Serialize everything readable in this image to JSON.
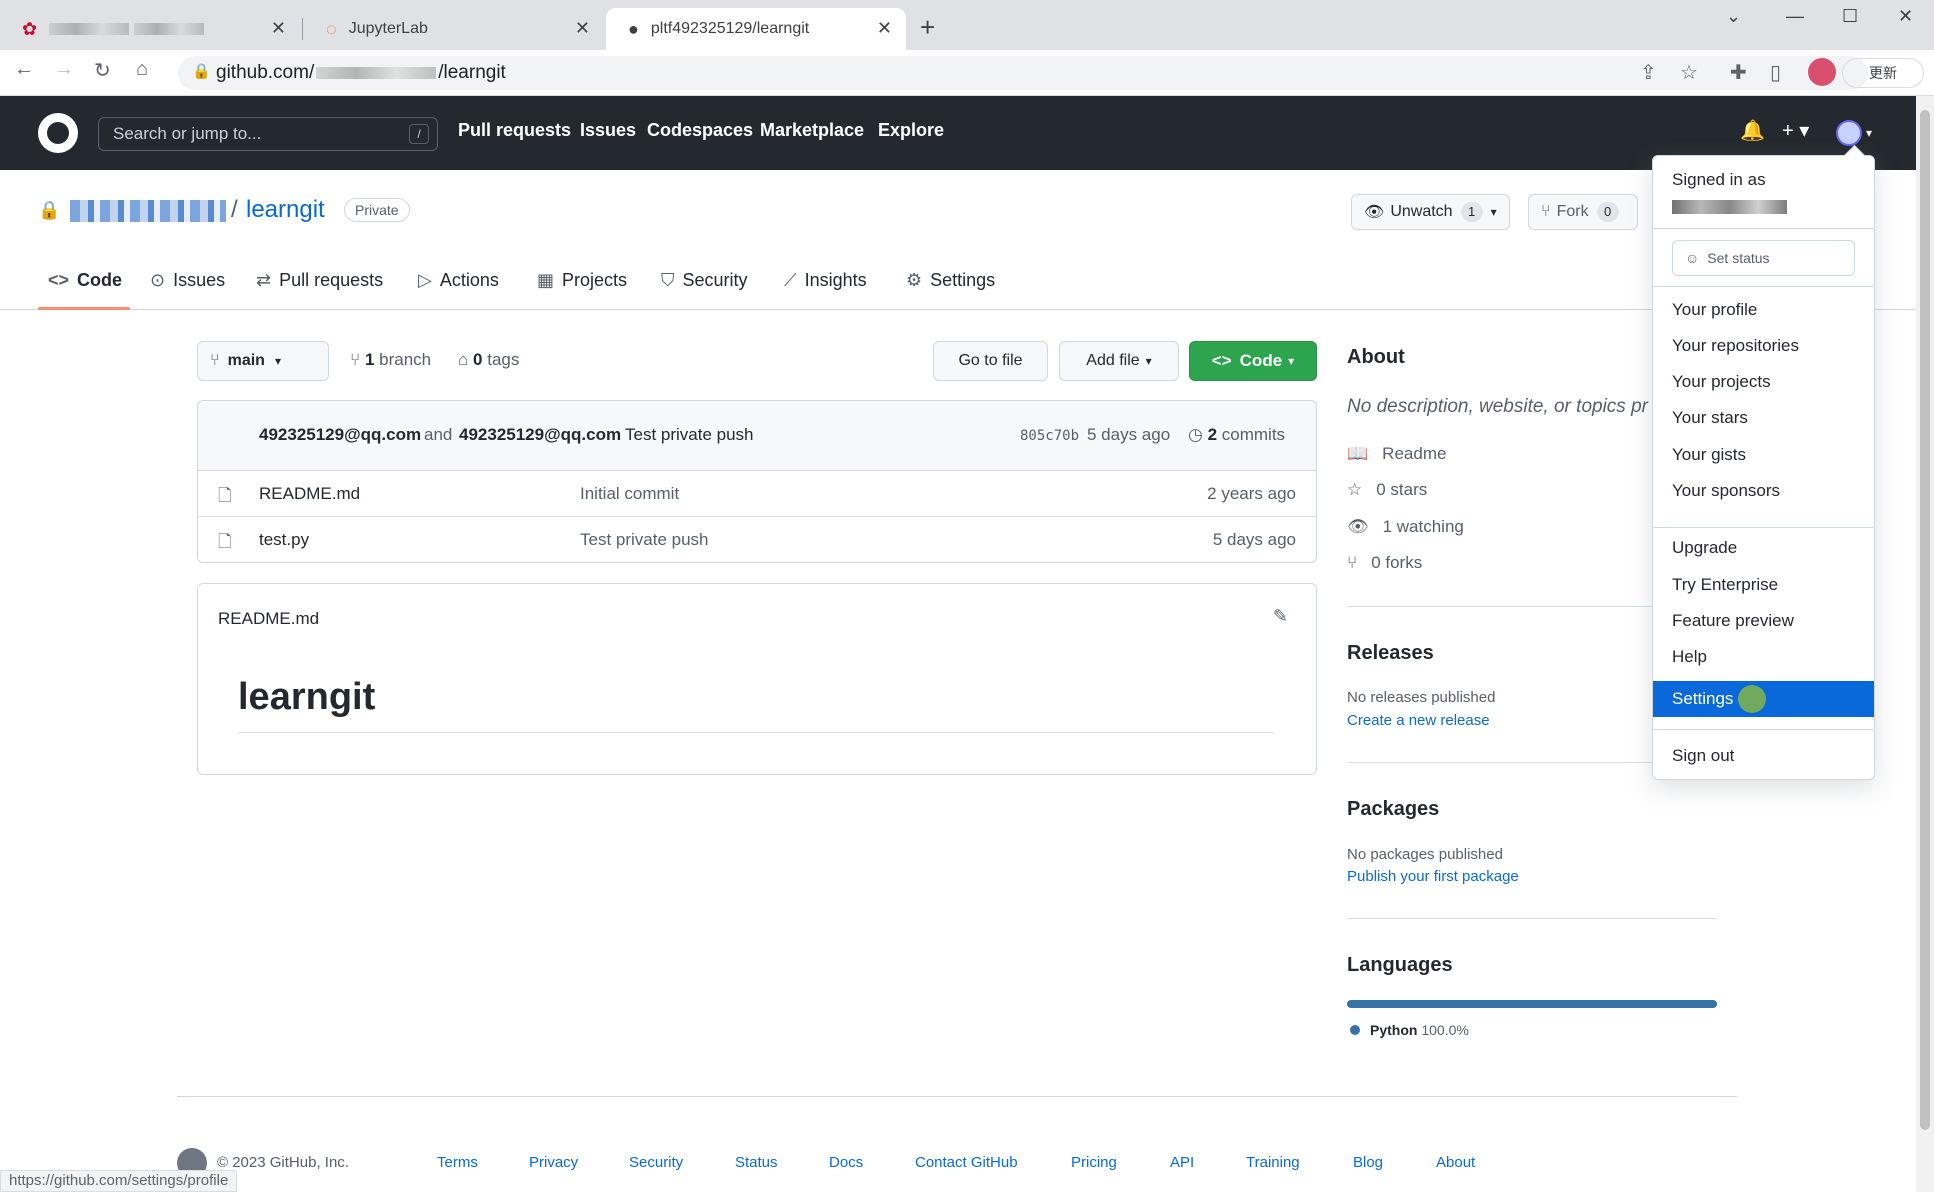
{
  "browser": {
    "tabs": [
      {
        "title": "",
        "favicon": "huawei-icon"
      },
      {
        "title": "JupyterLab",
        "favicon": "jupyter-icon"
      },
      {
        "title": "pltf492325129/learngit",
        "favicon": "github-icon"
      }
    ],
    "url": "github.com/",
    "url_suffix": "/learngit",
    "update_label": "更新",
    "status_url": "https://github.com/settings/profile"
  },
  "header": {
    "search_placeholder": "Search or jump to...",
    "search_shortcut": "/",
    "nav": [
      "Pull requests",
      "Issues",
      "Codespaces",
      "Marketplace",
      "Explore"
    ]
  },
  "repo": {
    "name": "learngit",
    "visibility": "Private",
    "unwatch_label": "Unwatch",
    "unwatch_count": "1",
    "fork_label": "Fork",
    "fork_count": "0",
    "tabs": [
      "Code",
      "Issues",
      "Pull requests",
      "Actions",
      "Projects",
      "Security",
      "Insights",
      "Settings"
    ],
    "branch": "main",
    "branch_count": "1",
    "branch_label": "branch",
    "tag_count": "0",
    "tag_label": "tags",
    "go_to_file": "Go to file",
    "add_file": "Add file",
    "code_button": "Code"
  },
  "commit": {
    "author1": "492325129@qq.com",
    "and": "and",
    "author2": "492325129@qq.com",
    "message": "Test private push",
    "sha": "805c70b",
    "time": "5 days ago",
    "commit_count": "2",
    "commits_label": "commits"
  },
  "files": [
    {
      "name": "README.md",
      "message": "Initial commit",
      "time": "2 years ago"
    },
    {
      "name": "test.py",
      "message": "Test private push",
      "time": "5 days ago"
    }
  ],
  "readme": {
    "filename": "README.md",
    "heading": "learngit"
  },
  "about": {
    "title": "About",
    "description": "No description, website, or topics pr",
    "readme": "Readme",
    "stars": "0 stars",
    "watching": "1 watching",
    "forks": "0 forks"
  },
  "releases": {
    "title": "Releases",
    "none": "No releases published",
    "create": "Create a new release"
  },
  "packages": {
    "title": "Packages",
    "none": "No packages published",
    "publish": "Publish your first package"
  },
  "languages": {
    "title": "Languages",
    "items": [
      {
        "name": "Python",
        "percent": "100.0%",
        "color": "#3572A5",
        "fraction": 1.0
      }
    ]
  },
  "menu": {
    "signed_in_as": "Signed in as",
    "set_status": "Set status",
    "items_group1": [
      "Your profile",
      "Your repositories",
      "Your projects",
      "Your stars",
      "Your gists",
      "Your sponsors"
    ],
    "items_group2": [
      "Upgrade",
      "Try Enterprise",
      "Feature preview",
      "Help",
      "Settings"
    ],
    "sign_out": "Sign out",
    "highlighted": "Settings"
  },
  "footer": {
    "copyright": "© 2023 GitHub, Inc.",
    "links": [
      "Terms",
      "Privacy",
      "Security",
      "Status",
      "Docs",
      "Contact GitHub",
      "Pricing",
      "API",
      "Training",
      "Blog",
      "About"
    ]
  },
  "colors": {
    "accent": "#0969da",
    "green": "#2da44e",
    "header_bg": "#24292f"
  }
}
